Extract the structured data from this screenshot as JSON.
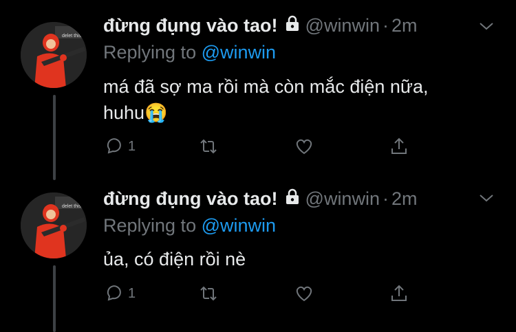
{
  "tweets": [
    {
      "display_name": "đừng đụng vào tao!",
      "handle": "@winwin",
      "separator": "·",
      "time": "2m",
      "replying_prefix": "Replying to ",
      "replying_to": "@winwin",
      "text_line1": "má đã sợ ma rồi mà còn mắc điện nữa,",
      "text_line2": "huhu",
      "emoji": "😭",
      "reply_count": "1",
      "avatar_caption": "delet this"
    },
    {
      "display_name": "đừng đụng vào tao!",
      "handle": "@winwin",
      "separator": "·",
      "time": "2m",
      "replying_prefix": "Replying to ",
      "replying_to": "@winwin",
      "text_line1": "ủa, có điện rồi nè",
      "reply_count": "1",
      "avatar_caption": "delet this"
    }
  ],
  "icons": {
    "lock": "lock-icon",
    "chevron": "chevron-down-icon",
    "reply": "reply-icon",
    "retweet": "retweet-icon",
    "like": "heart-icon",
    "share": "share-icon"
  },
  "colors": {
    "background": "#000000",
    "text": "#e7e9ea",
    "muted": "#71767b",
    "accent": "#1d9bf0",
    "avatar_figure": "#e0341f"
  }
}
